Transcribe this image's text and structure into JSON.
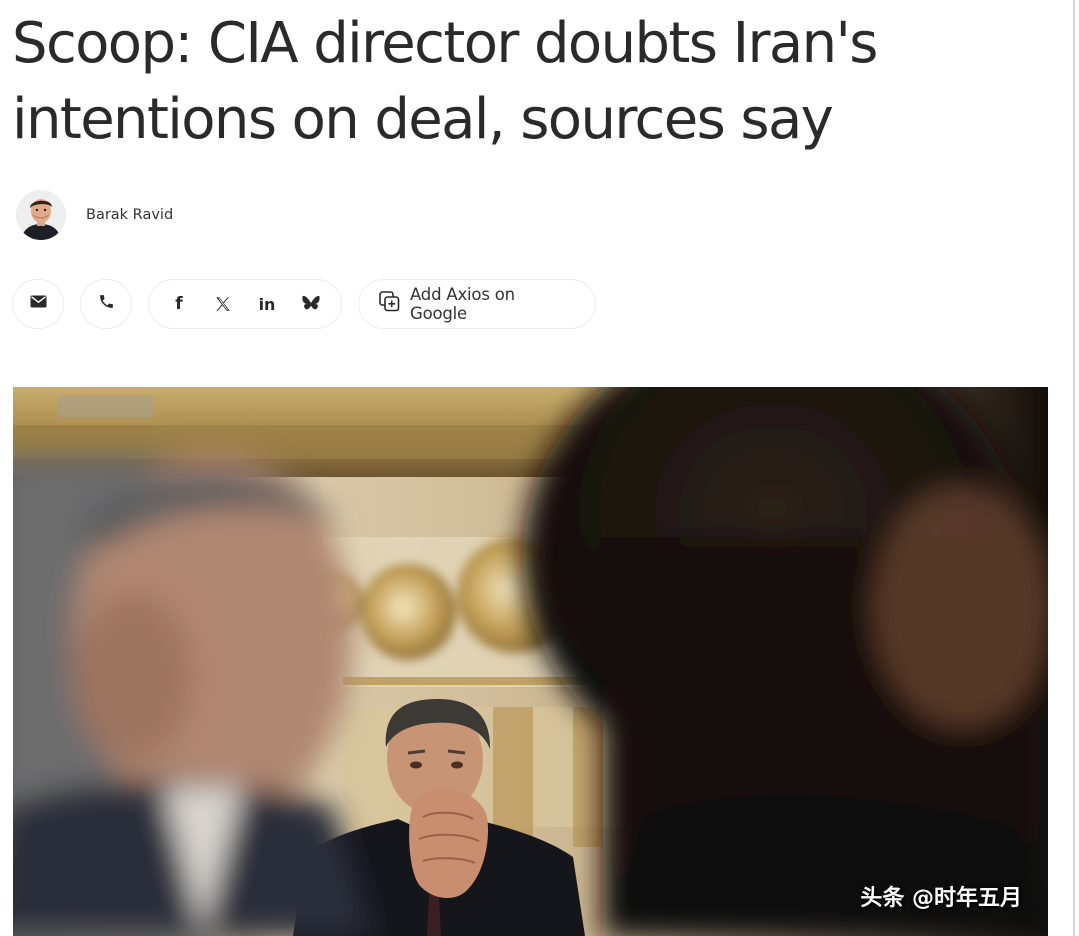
{
  "article": {
    "headline_line1": "Scoop: CIA director doubts Iran's",
    "headline_line2": "intentions on deal, sources say",
    "author": "Barak Ravid"
  },
  "share": {
    "email_icon": "envelope-icon",
    "phone_icon": "phone-icon",
    "social": [
      "facebook-icon",
      "x-icon",
      "linkedin-icon",
      "bluesky-icon"
    ],
    "add_google_label": "Add Axios on Google",
    "add_google_icon": "add-source-icon"
  },
  "photo": {
    "watermark": "头条 @时年五月"
  },
  "colors": {
    "headline": "#2a2a2a",
    "border": "#ececec",
    "text": "#333333"
  }
}
